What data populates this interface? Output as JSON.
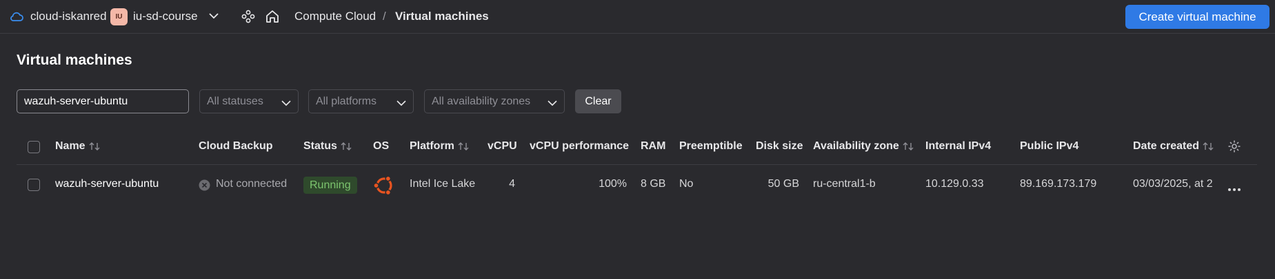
{
  "topbar": {
    "cloud_name": "cloud-iskanred",
    "folder_avatar": "IU",
    "folder_name": "iu-sd-course",
    "breadcrumb_service": "Compute Cloud",
    "breadcrumb_separator": "/",
    "breadcrumb_current": "Virtual machines",
    "create_button": "Create virtual machine",
    "icons": [
      "cloud-icon",
      "chevron-down-icon",
      "services-icon",
      "home-icon"
    ]
  },
  "page": {
    "title": "Virtual machines"
  },
  "filters": {
    "search_value": "wazuh-server-ubuntu",
    "status_select": "All statuses",
    "platform_select": "All platforms",
    "zone_select": "All availability zones",
    "clear_button": "Clear"
  },
  "table": {
    "columns": {
      "name": "Name",
      "cloud_backup": "Cloud Backup",
      "status": "Status",
      "os": "OS",
      "platform": "Platform",
      "vcpu": "vCPU",
      "vcpu_performance": "vCPU performance",
      "ram": "RAM",
      "preemptible": "Preemptible",
      "disk_size": "Disk size",
      "availability_zone": "Availability zone",
      "internal_ipv4": "Internal IPv4",
      "public_ipv4": "Public IPv4",
      "date_created": "Date created"
    },
    "rows": [
      {
        "name": "wazuh-server-ubuntu",
        "cloud_backup": "Not connected",
        "status": "Running",
        "os_icon": "ubuntu-icon",
        "platform": "Intel Ice Lake",
        "vcpu": "4",
        "vcpu_performance": "100%",
        "ram": "8 GB",
        "preemptible": "No",
        "disk_size": "50 GB",
        "availability_zone": "ru-central1-b",
        "internal_ipv4": "10.129.0.33",
        "public_ipv4": "89.169.173.179",
        "date_created": "03/03/2025, at 2"
      }
    ]
  },
  "colors": {
    "background": "#2a2a2e",
    "accent": "#2f7ae5",
    "running_badge_bg": "#2f4a2c",
    "running_badge_text": "#7cc46e",
    "ubuntu_orange": "#e95420"
  }
}
